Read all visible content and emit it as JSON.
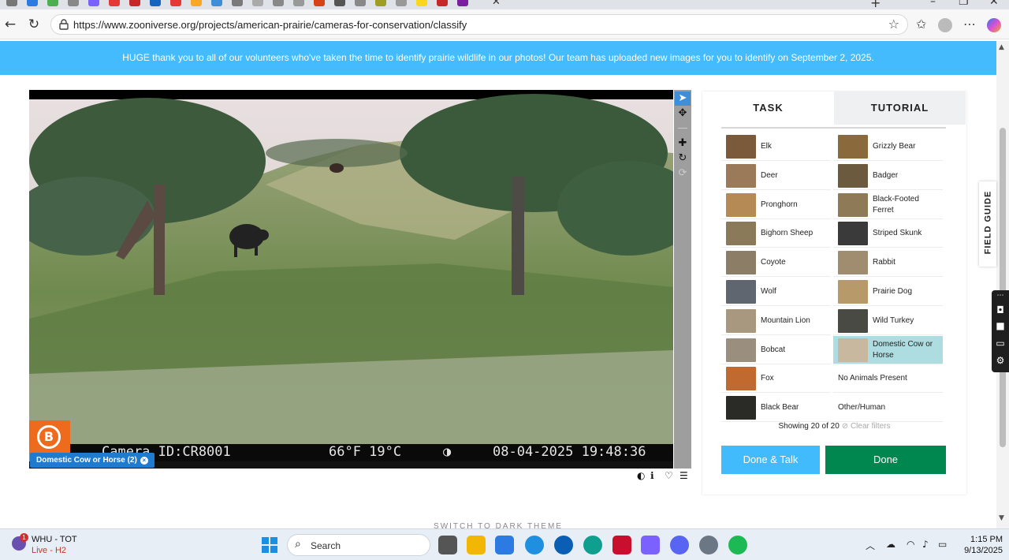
{
  "browser": {
    "url": "https://www.zooniverse.org/projects/american-prairie/cameras-for-conservation/classify"
  },
  "banner": {
    "text": "HUGE thank you to all of our volunteers who've taken the time to identify prairie wildlife in our photos! Our team has uploaded new images for you to identify on September 2, 2025."
  },
  "viewer": {
    "camera_brand": "Bushnell",
    "camera_id": "Camera ID:CR8001",
    "temperature": "66°F 19°C",
    "timestamp": "08-04-2025 19:48:36",
    "subject_tag": "Domestic Cow or Horse (2)"
  },
  "tabs": {
    "task": "TASK",
    "tutorial": "TUTORIAL"
  },
  "species": [
    {
      "label": "Elk",
      "color": "#7a5a3a"
    },
    {
      "label": "Grizzly Bear",
      "color": "#8a6a3c"
    },
    {
      "label": "Deer",
      "color": "#9a7a58"
    },
    {
      "label": "Badger",
      "color": "#6b5a3e"
    },
    {
      "label": "Pronghorn",
      "color": "#b58a55"
    },
    {
      "label": "Black-Footed Ferret",
      "color": "#8f7a58"
    },
    {
      "label": "Bighorn Sheep",
      "color": "#8a7a5a"
    },
    {
      "label": "Striped Skunk",
      "color": "#3a3a3a"
    },
    {
      "label": "Coyote",
      "color": "#8c7e66"
    },
    {
      "label": "Rabbit",
      "color": "#a08d70"
    },
    {
      "label": "Wolf",
      "color": "#606670"
    },
    {
      "label": "Prairie Dog",
      "color": "#b89a6a"
    },
    {
      "label": "Mountain Lion",
      "color": "#a89880"
    },
    {
      "label": "Wild Turkey",
      "color": "#4a4a44"
    },
    {
      "label": "Bobcat",
      "color": "#9a8e7e"
    },
    {
      "label": "Domestic Cow or Horse",
      "color": "#c8b8a0",
      "selected": true
    },
    {
      "label": "Fox",
      "color": "#c06a30"
    },
    {
      "label": "No Animals Present",
      "noimg": true
    },
    {
      "label": "Black Bear",
      "color": "#2a2a26"
    },
    {
      "label": "Other/Human",
      "noimg": true
    }
  ],
  "filter": {
    "showing": "Showing 20 of 20",
    "clear": "Clear filters"
  },
  "buttons": {
    "done_talk": "Done & Talk",
    "done": "Done"
  },
  "field_guide": "FIELD GUIDE",
  "footer": {
    "dark_theme": "SWITCH TO DARK THEME"
  },
  "taskbar": {
    "weather_title": "WHU - TOT",
    "weather_sub": "Live - H2",
    "weather_badge": "1",
    "search": "Search",
    "time": "1:15 PM",
    "date": "9/13/2025"
  }
}
